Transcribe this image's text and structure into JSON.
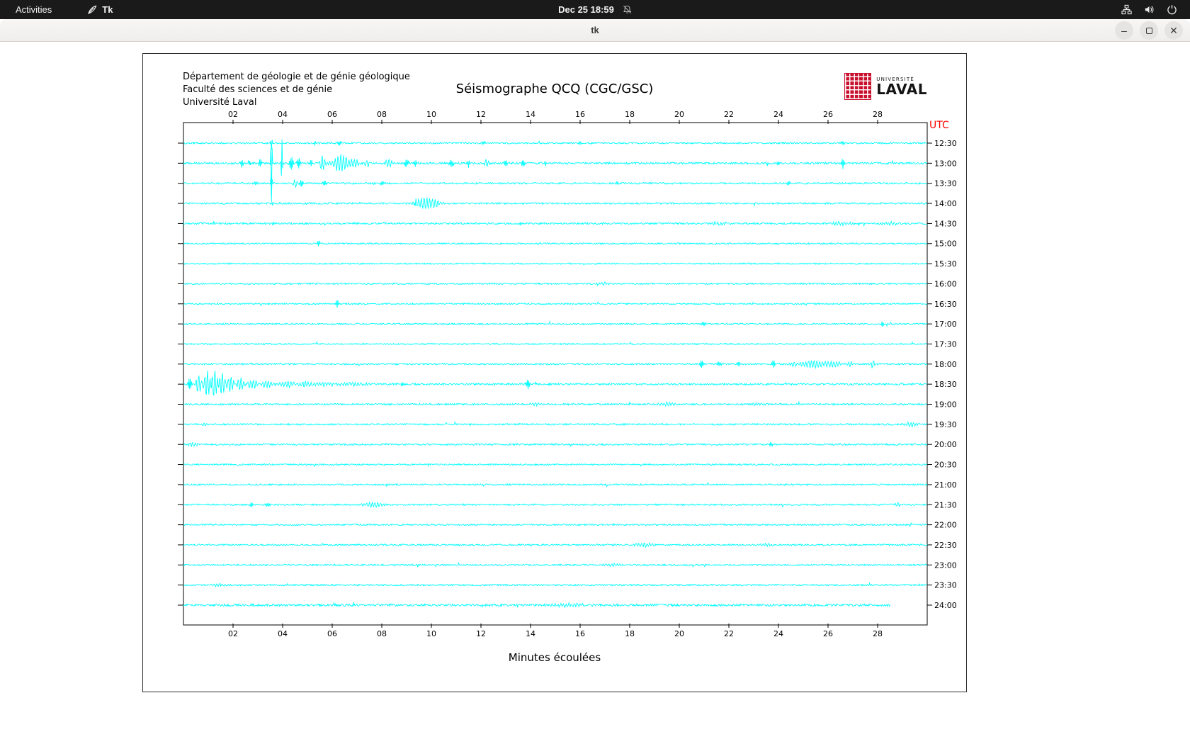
{
  "topbar": {
    "activities": "Activities",
    "app_label": "Tk",
    "clock": "Dec 25  18:59"
  },
  "titlebar": {
    "title": "tk",
    "minimize_glyph": "–",
    "close_glyph": "✕"
  },
  "icons": {
    "topbar_right": [
      "network-icon",
      "volume-icon",
      "power-icon"
    ],
    "clock_area": [
      "notifications-muted-icon"
    ],
    "app": [
      "tk-feather-icon"
    ]
  },
  "window": {
    "header_lines": [
      "Département de géologie et de génie géologique",
      "Faculté des sciences et de génie",
      "Université Laval"
    ],
    "title": "Séismographe QCQ (CGC/GSC)",
    "utc_label": "UTC",
    "xlabel": "Minutes écoulées",
    "logo_small": "UNIVERSITÉ",
    "logo_large": "LAVAL"
  },
  "chart_data": {
    "type": "line",
    "title": "Séismographe QCQ (CGC/GSC)",
    "xlabel": "Minutes écoulées",
    "x_range": [
      0,
      30
    ],
    "x_tick_values": [
      2,
      4,
      6,
      8,
      10,
      12,
      14,
      16,
      18,
      20,
      22,
      24,
      26,
      28
    ],
    "x_ticks": [
      "02",
      "04",
      "06",
      "08",
      "10",
      "12",
      "14",
      "16",
      "18",
      "20",
      "22",
      "24",
      "26",
      "28"
    ],
    "trace_color": "#00ffff",
    "row_spacing_px": 28.348,
    "event_format": "[minute, amplitude_px, width_min]",
    "rows": [
      {
        "label": "12:30",
        "seed": 1,
        "noise": 1.1,
        "end": 30,
        "events": [
          [
            3.55,
            9,
            0.02
          ],
          [
            5.3,
            3,
            0.03
          ],
          [
            6.3,
            2.5,
            0.05
          ],
          [
            12.1,
            2.5,
            0.04
          ],
          [
            16.0,
            2,
            0.05
          ],
          [
            26.6,
            2.5,
            0.04
          ]
        ]
      },
      {
        "label": "13:00",
        "seed": 2,
        "noise": 1.4,
        "end": 30,
        "events": [
          [
            2.35,
            5,
            0.04
          ],
          [
            2.65,
            4,
            0.03
          ],
          [
            3.1,
            6,
            0.04
          ],
          [
            3.55,
            55,
            0.018
          ],
          [
            3.97,
            34,
            0.018
          ],
          [
            4.35,
            9,
            0.05
          ],
          [
            4.65,
            7,
            0.05
          ],
          [
            5.15,
            5,
            0.04
          ],
          [
            5.6,
            11,
            0.08
          ],
          [
            6.35,
            13,
            0.22
          ],
          [
            6.9,
            6,
            0.12
          ],
          [
            7.4,
            5,
            0.08
          ],
          [
            8.3,
            7,
            0.1
          ],
          [
            9.0,
            5,
            0.06
          ],
          [
            9.35,
            4,
            0.05
          ],
          [
            10.8,
            5,
            0.06
          ],
          [
            11.5,
            3.5,
            0.05
          ],
          [
            12.2,
            5,
            0.07
          ],
          [
            13.0,
            3.5,
            0.05
          ],
          [
            13.7,
            4,
            0.05
          ],
          [
            14.6,
            3,
            0.05
          ],
          [
            24.0,
            2.5,
            0.04
          ],
          [
            26.6,
            7,
            0.04
          ]
        ]
      },
      {
        "label": "13:30",
        "seed": 3,
        "noise": 1.2,
        "end": 30,
        "events": [
          [
            2.9,
            3,
            0.04
          ],
          [
            3.55,
            19,
            0.018
          ],
          [
            4.5,
            6,
            0.07
          ],
          [
            4.75,
            5,
            0.05
          ],
          [
            5.7,
            3.5,
            0.05
          ],
          [
            8.0,
            2.5,
            0.04
          ],
          [
            17.5,
            2,
            0.04
          ],
          [
            24.4,
            2.5,
            0.05
          ]
        ]
      },
      {
        "label": "14:00",
        "seed": 4,
        "noise": 1.15,
        "end": 30,
        "events": [
          [
            3.6,
            3,
            0.02
          ],
          [
            9.35,
            3.5,
            0.05
          ],
          [
            9.75,
            8,
            0.3
          ],
          [
            10.2,
            3,
            0.1
          ]
        ]
      },
      {
        "label": "14:30",
        "seed": 5,
        "noise": 1.25,
        "end": 30,
        "events": [
          [
            3.6,
            2.5,
            0.02
          ],
          [
            13.6,
            2,
            0.05
          ],
          [
            21.5,
            2,
            0.3
          ],
          [
            26.5,
            2.2,
            0.4
          ],
          [
            28.5,
            2.2,
            0.3
          ]
        ]
      },
      {
        "label": "15:00",
        "seed": 6,
        "noise": 1.0,
        "end": 30,
        "events": [
          [
            5.45,
            4.5,
            0.03
          ]
        ]
      },
      {
        "label": "15:30",
        "seed": 7,
        "noise": 1.0,
        "end": 30,
        "events": []
      },
      {
        "label": "16:00",
        "seed": 8,
        "noise": 1.05,
        "end": 30,
        "events": [
          [
            17.0,
            1.8,
            0.2
          ]
        ]
      },
      {
        "label": "16:30",
        "seed": 9,
        "noise": 1.0,
        "end": 30,
        "events": [
          [
            6.2,
            6,
            0.035
          ]
        ]
      },
      {
        "label": "17:00",
        "seed": 10,
        "noise": 1.05,
        "end": 30,
        "events": [
          [
            21.0,
            2.2,
            0.05
          ],
          [
            28.2,
            3.5,
            0.04
          ]
        ]
      },
      {
        "label": "17:30",
        "seed": 11,
        "noise": 1.0,
        "end": 30,
        "events": []
      },
      {
        "label": "18:00",
        "seed": 12,
        "noise": 1.1,
        "end": 30,
        "events": [
          [
            20.9,
            5.5,
            0.05
          ],
          [
            21.6,
            3,
            0.06
          ],
          [
            22.4,
            2.5,
            0.05
          ],
          [
            23.8,
            4.5,
            0.05
          ],
          [
            24.6,
            3,
            0.08
          ],
          [
            25.4,
            5,
            0.45
          ],
          [
            26.2,
            4,
            0.25
          ],
          [
            26.9,
            3,
            0.1
          ],
          [
            27.8,
            5.5,
            0.07
          ]
        ]
      },
      {
        "label": "18:30",
        "seed": 13,
        "noise": 1.3,
        "end": 30,
        "events": [
          [
            0.25,
            8,
            0.05
          ],
          [
            0.6,
            14,
            0.08
          ],
          [
            0.95,
            20,
            0.09
          ],
          [
            1.25,
            21,
            0.09
          ],
          [
            1.55,
            17,
            0.09
          ],
          [
            1.9,
            12,
            0.1
          ],
          [
            2.3,
            9,
            0.12
          ],
          [
            2.8,
            7,
            0.15
          ],
          [
            3.4,
            5,
            0.2
          ],
          [
            4.2,
            4.5,
            0.2
          ],
          [
            4.9,
            3.5,
            0.2
          ],
          [
            5.7,
            2.5,
            0.3
          ],
          [
            6.8,
            2,
            0.4
          ],
          [
            8.85,
            3.5,
            0.04
          ],
          [
            13.9,
            7,
            0.05
          ],
          [
            14.8,
            2,
            0.05
          ]
        ]
      },
      {
        "label": "19:00",
        "seed": 14,
        "noise": 1.15,
        "end": 30,
        "events": [
          [
            14.2,
            1.8,
            0.2
          ],
          [
            19.5,
            2.2,
            0.3
          ],
          [
            23.2,
            1.8,
            0.2
          ]
        ]
      },
      {
        "label": "19:30",
        "seed": 15,
        "noise": 1.2,
        "end": 30,
        "events": [
          [
            0.85,
            2.8,
            0.1
          ],
          [
            29.35,
            3,
            0.2
          ]
        ]
      },
      {
        "label": "20:00",
        "seed": 16,
        "noise": 1.15,
        "end": 30,
        "events": [
          [
            0.4,
            3.5,
            0.12
          ],
          [
            23.7,
            2.5,
            0.05
          ]
        ]
      },
      {
        "label": "20:30",
        "seed": 17,
        "noise": 1.05,
        "end": 30,
        "events": []
      },
      {
        "label": "21:00",
        "seed": 18,
        "noise": 1.05,
        "end": 30,
        "events": []
      },
      {
        "label": "21:30",
        "seed": 19,
        "noise": 1.1,
        "end": 30,
        "events": [
          [
            2.75,
            2.8,
            0.05
          ],
          [
            3.4,
            2.2,
            0.05
          ],
          [
            7.7,
            3.5,
            0.3
          ],
          [
            28.8,
            2.5,
            0.08
          ]
        ]
      },
      {
        "label": "22:00",
        "seed": 20,
        "noise": 1.05,
        "end": 30,
        "events": []
      },
      {
        "label": "22:30",
        "seed": 21,
        "noise": 1.15,
        "end": 30,
        "events": [
          [
            18.6,
            2.8,
            0.25
          ],
          [
            23.5,
            2.2,
            0.2
          ]
        ]
      },
      {
        "label": "23:00",
        "seed": 22,
        "noise": 1.05,
        "end": 30,
        "events": [
          [
            17.3,
            1.8,
            0.3
          ]
        ]
      },
      {
        "label": "23:30",
        "seed": 23,
        "noise": 1.1,
        "end": 30,
        "events": [
          [
            1.4,
            1.8,
            0.3
          ]
        ]
      },
      {
        "label": "24:00",
        "seed": 24,
        "noise": 1.6,
        "end": 28.5,
        "events": [
          [
            15.5,
            2,
            0.5
          ]
        ]
      }
    ]
  }
}
